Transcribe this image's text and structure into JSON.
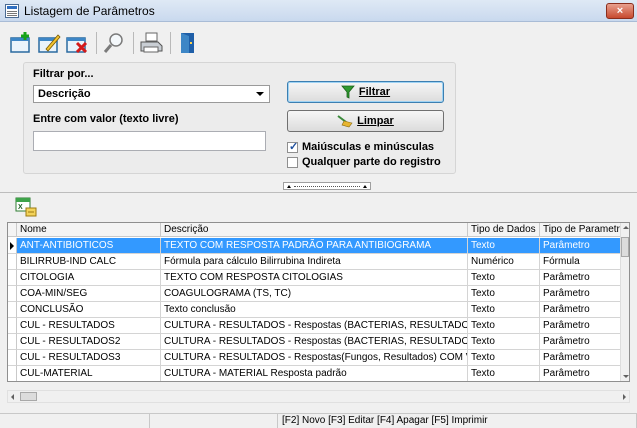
{
  "window": {
    "title": "Listagem de Parâmetros",
    "close_label": "×"
  },
  "toolbar": {
    "buttons": [
      {
        "icon": "new-record-icon"
      },
      {
        "icon": "edit-record-icon"
      },
      {
        "icon": "delete-record-icon"
      },
      {
        "icon": "search-icon"
      },
      {
        "icon": "print-icon"
      },
      {
        "icon": "exit-door-icon"
      }
    ]
  },
  "filter": {
    "group_label": "Filtrar por...",
    "field_selected": "Descrição",
    "value_label": "Entre com valor (texto livre)",
    "value": "",
    "filter_button": "Filtrar",
    "clear_button": "Limpar",
    "case_checkbox_label": "Maiúsculas e minúsculas",
    "case_checked": true,
    "anypart_checkbox_label": "Qualquer parte do registro",
    "anypart_checked": false
  },
  "grid": {
    "columns": [
      "Nome",
      "Descrição",
      "Tipo de Dados",
      "Tipo de Parametro"
    ],
    "rows": [
      {
        "nome": "ANT-ANTIBIOTICOS",
        "descricao": "TEXTO COM RESPOSTA PADRÃO PARA ANTIBIOGRAMA",
        "tipo_dados": "Texto",
        "tipo_param": "Parâmetro",
        "selected": true
      },
      {
        "nome": "BILIRRUB-IND CALC",
        "descricao": "Fórmula para cálculo Bilirrubina Indireta",
        "tipo_dados": "Numérico",
        "tipo_param": "Fórmula"
      },
      {
        "nome": "CITOLOGIA",
        "descricao": "TEXTO COM RESPOSTA CITOLOGIAS",
        "tipo_dados": "Texto",
        "tipo_param": "Parâmetro"
      },
      {
        "nome": "COA-MIN/SEG",
        "descricao": "COAGULOGRAMA (TS, TC)",
        "tipo_dados": "Texto",
        "tipo_param": "Parâmetro"
      },
      {
        "nome": "CONCLUSÃO",
        "descricao": "Texto conclusão",
        "tipo_dados": "Texto",
        "tipo_param": "Parâmetro"
      },
      {
        "nome": "CUL - RESULTADOS",
        "descricao": "CULTURA - RESULTADOS  - Respostas (BACTERIAS, RESULTADOS) CO",
        "tipo_dados": "Texto",
        "tipo_param": "Parâmetro"
      },
      {
        "nome": "CUL - RESULTADOS2",
        "descricao": "CULTURA - RESULTADOS  - Respostas (BACTERIAS, RESULTADOS) SEI",
        "tipo_dados": "Texto",
        "tipo_param": "Parâmetro"
      },
      {
        "nome": "CUL - RESULTADOS3",
        "descricao": "CULTURA - RESULTADOS  - Respostas(Fungos, Resultados)  COM VALC",
        "tipo_dados": "Texto",
        "tipo_param": "Parâmetro"
      },
      {
        "nome": "CUL-MATERIAL",
        "descricao": "CULTURA - MATERIAL Resposta padrão",
        "tipo_dados": "Texto",
        "tipo_param": "Parâmetro"
      }
    ]
  },
  "status": {
    "shortcuts": "[F2] Novo [F3] Editar [F4] Apagar [F5] Imprimir"
  }
}
